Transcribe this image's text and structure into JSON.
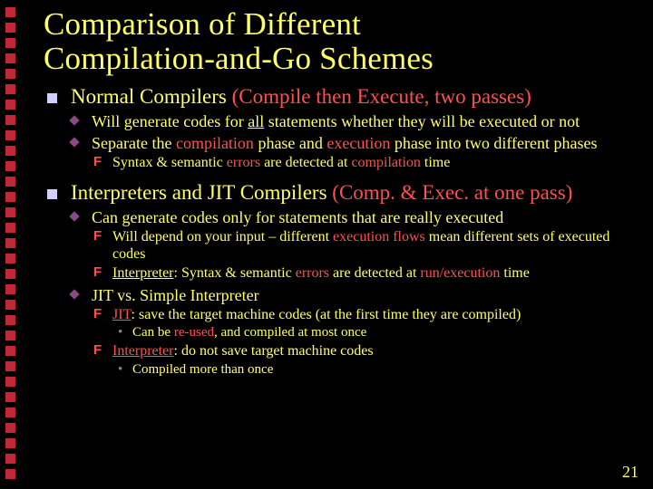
{
  "title_l1": "Comparison of Different",
  "title_l2": "Compilation-and-Go Schemes",
  "a": {
    "head_pre": "Normal Compilers ",
    "head_paren": "(Compile then Execute, two passes)",
    "p1_a": "Will generate codes for ",
    "p1_b": "all",
    "p1_c": " statements whether they will be executed or not",
    "p2_a": "Separate the ",
    "p2_b": "compilation",
    "p2_c": " phase and ",
    "p2_d": "execution",
    "p2_e": " phase into two different phases",
    "p2s_a": "Syntax & semantic ",
    "p2s_b": "errors",
    "p2s_c": " are detected at ",
    "p2s_d": "compilation",
    "p2s_e": " time"
  },
  "b": {
    "head_pre": "Interpreters and JIT Compilers ",
    "head_paren": "(Comp. & Exec. at one pass)",
    "p1": "Can generate codes only for statements that are really executed",
    "p1s1_a": "Will depend on your input – different ",
    "p1s1_b": "execution flows",
    "p1s1_c": " mean different sets of executed codes",
    "p1s2_a": "Interpreter",
    "p1s2_b": ": Syntax & semantic ",
    "p1s2_c": "errors",
    "p1s2_d": " are detected at ",
    "p1s2_e": "run/execution",
    "p1s2_f": " time",
    "p2": "JIT vs. Simple Interpreter",
    "p2s1_a": "JIT",
    "p2s1_b": ": save the target machine codes (at the first time they are compiled)",
    "p2s1b_a": "Can be ",
    "p2s1b_b": "re-used",
    "p2s1b_c": ", and compiled at most once",
    "p2s2_a": "Interpreter",
    "p2s2_b": ": do not save target machine codes",
    "p2s2b": "Compiled more than once"
  },
  "page_number": "21"
}
